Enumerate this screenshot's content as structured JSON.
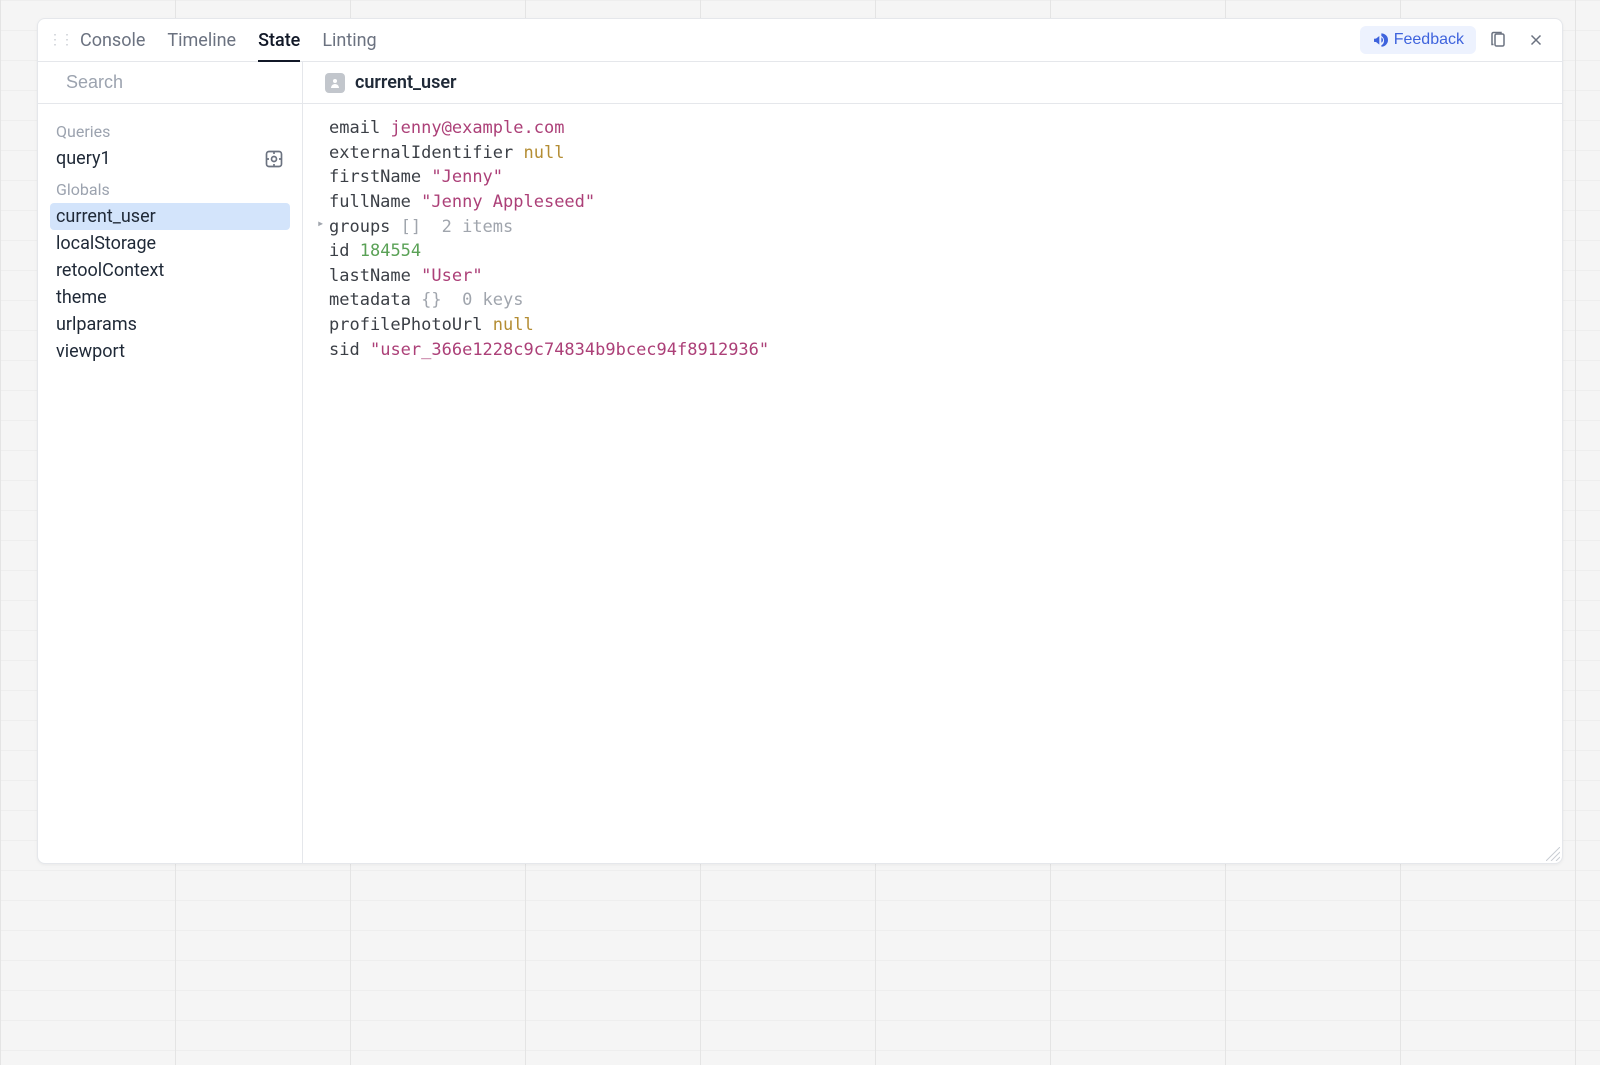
{
  "tabs": [
    "Console",
    "Timeline",
    "State",
    "Linting"
  ],
  "activeTab": "State",
  "feedbackLabel": "Feedback",
  "search": {
    "placeholder": "Search"
  },
  "sidebar": {
    "sections": [
      {
        "label": "Queries",
        "items": [
          {
            "name": "query1",
            "hasInspect": true
          }
        ]
      },
      {
        "label": "Globals",
        "items": [
          {
            "name": "current_user",
            "selected": true
          },
          {
            "name": "localStorage"
          },
          {
            "name": "retoolContext"
          },
          {
            "name": "theme"
          },
          {
            "name": "urlparams"
          },
          {
            "name": "viewport"
          }
        ]
      }
    ]
  },
  "main": {
    "title": "current_user",
    "properties": [
      {
        "key": "email",
        "type": "bare-string",
        "value": "jenny@example.com"
      },
      {
        "key": "externalIdentifier",
        "type": "null"
      },
      {
        "key": "firstName",
        "type": "string",
        "value": "Jenny"
      },
      {
        "key": "fullName",
        "type": "string",
        "value": "Jenny Appleseed"
      },
      {
        "key": "groups",
        "type": "array",
        "summary": "2 items"
      },
      {
        "key": "id",
        "type": "number",
        "value": "184554"
      },
      {
        "key": "lastName",
        "type": "string",
        "value": "User"
      },
      {
        "key": "metadata",
        "type": "object",
        "summary": "0 keys"
      },
      {
        "key": "profilePhotoUrl",
        "type": "null"
      },
      {
        "key": "sid",
        "type": "string",
        "value": "user_366e1228c9c74834b9bcec94f8912936"
      }
    ]
  }
}
